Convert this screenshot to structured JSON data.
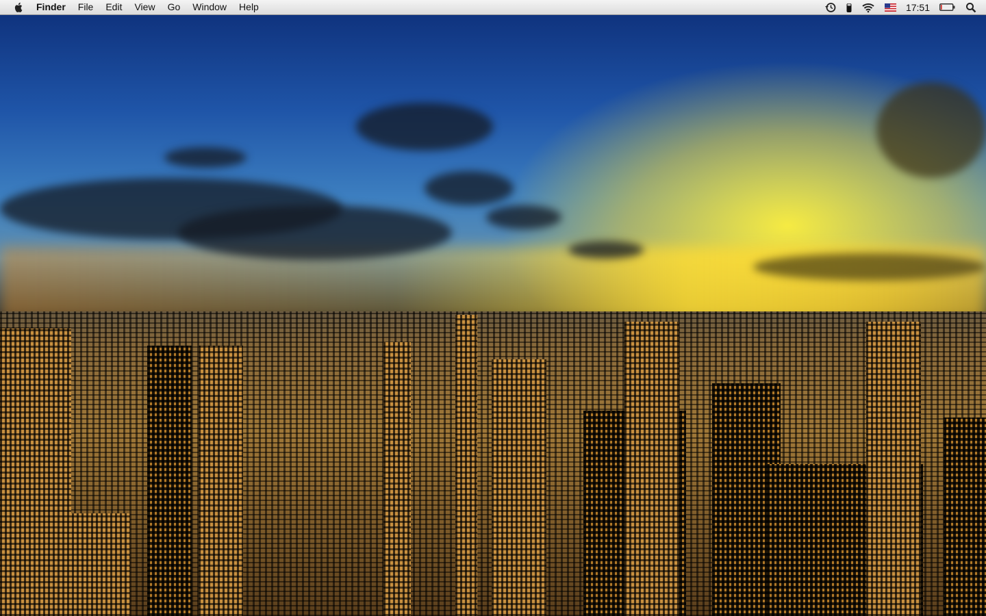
{
  "menubar": {
    "app_name": "Finder",
    "menus": [
      "File",
      "Edit",
      "View",
      "Go",
      "Window",
      "Help"
    ],
    "status": {
      "icons": [
        "time-machine-icon",
        "bluetooth-battery-icon",
        "wifi-icon",
        "us-flag-input-icon",
        "battery-icon",
        "spotlight-icon"
      ],
      "clock": "17:51",
      "battery_level_fraction": 0.1
    }
  },
  "desktop": {
    "wallpaper": "city-sunset"
  },
  "colors": {
    "battery_low": "#d8302a"
  }
}
